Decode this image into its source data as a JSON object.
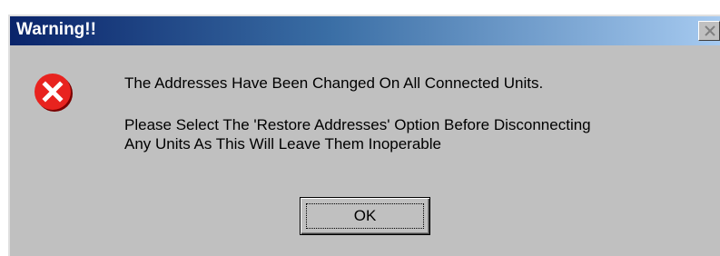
{
  "window": {
    "title": "Warning!!",
    "close_icon": "close-icon"
  },
  "message": {
    "icon": "error-icon",
    "line1": "The Addresses Have Been Changed On All Connected Units.",
    "line2": "Please Select The 'Restore Addresses' Option Before Disconnecting",
    "line3": "Any Units As This Will Leave Them Inoperable"
  },
  "buttons": {
    "ok_label": "OK"
  },
  "colors": {
    "titlebar_start": "#0a246a",
    "titlebar_end": "#a6caf0",
    "dialog_bg": "#c0c0c0",
    "error_red": "#e8231f"
  }
}
